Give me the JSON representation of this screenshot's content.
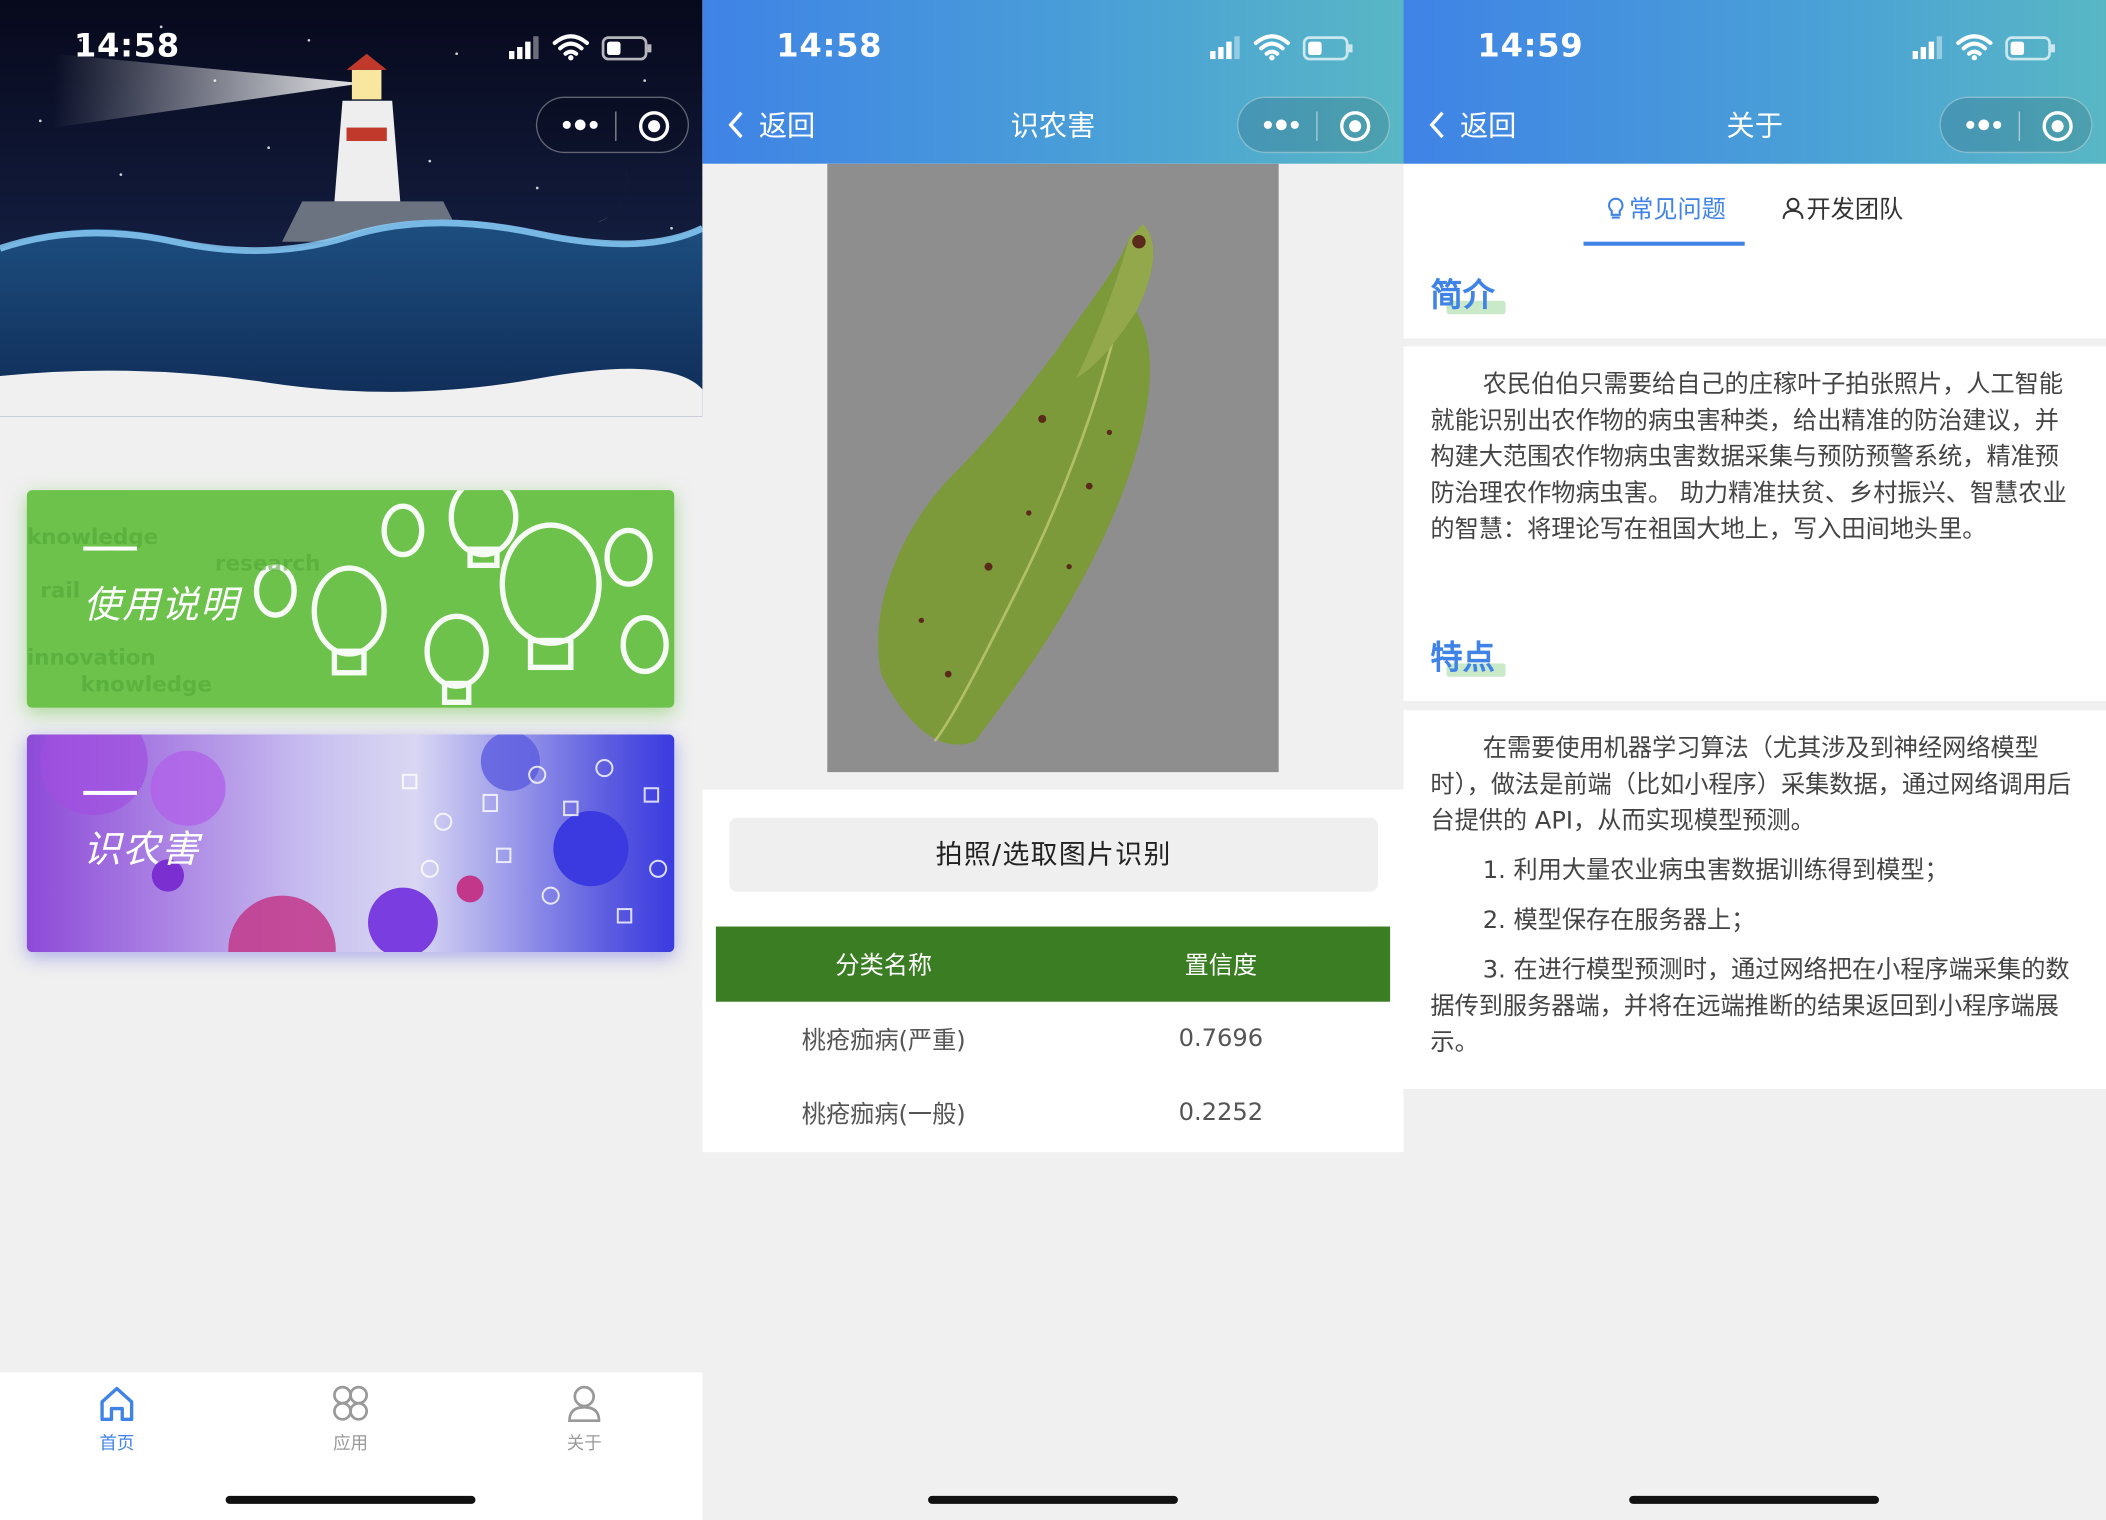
{
  "screens": [
    {
      "time": "14:58",
      "cards": [
        {
          "title": "使用说明"
        },
        {
          "title": "识农害"
        }
      ],
      "tabbar": [
        {
          "label": "首页",
          "icon": "home-icon",
          "active": true
        },
        {
          "label": "应用",
          "icon": "apps-icon",
          "active": false
        },
        {
          "label": "关于",
          "icon": "user-icon",
          "active": false
        }
      ],
      "colors": {
        "active": "#3f83e6",
        "inactive": "#999999"
      }
    },
    {
      "time": "14:58",
      "nav": {
        "back": "返回",
        "title": "识农害"
      },
      "button": "拍照/选取图片识别",
      "table": {
        "headers": [
          "分类名称",
          "置信度"
        ],
        "rows": [
          [
            "桃疮痂病(严重)",
            "0.7696"
          ],
          [
            "桃疮痂病(一般)",
            "0.2252"
          ]
        ]
      },
      "colors": {
        "header": "#3a7d23"
      }
    },
    {
      "time": "14:59",
      "nav": {
        "back": "返回",
        "title": "关于"
      },
      "tabs": [
        {
          "label": "常见问题",
          "icon": "bulb-icon",
          "active": true
        },
        {
          "label": "开发团队",
          "icon": "person-icon",
          "active": false
        }
      ],
      "intro": {
        "title": "简介",
        "text": "农民伯伯只需要给自己的庄稼叶子拍张照片，人工智能就能识别出农作物的病虫害种类，给出精准的防治建议，并构建大范围农作物病虫害数据采集与预防预警系统，精准预防治理农作物病虫害。 助力精准扶贫、乡村振兴、智慧农业的智慧：将理论写在祖国大地上，写入田间地头里。"
      },
      "features": {
        "title": "特点",
        "text": "在需要使用机器学习算法（尤其涉及到神经网络模型时），做法是前端（比如小程序）采集数据，通过网络调用后台提供的 API，从而实现模型预测。",
        "items": [
          "1. 利用大量农业病虫害数据训练得到模型；",
          "2. 模型保存在服务器上；",
          "3. 在进行模型预测时，通过网络把在小程序端采集的数据传到服务器端，并将在远端推断的结果返回到小程序端展示。"
        ]
      }
    }
  ]
}
